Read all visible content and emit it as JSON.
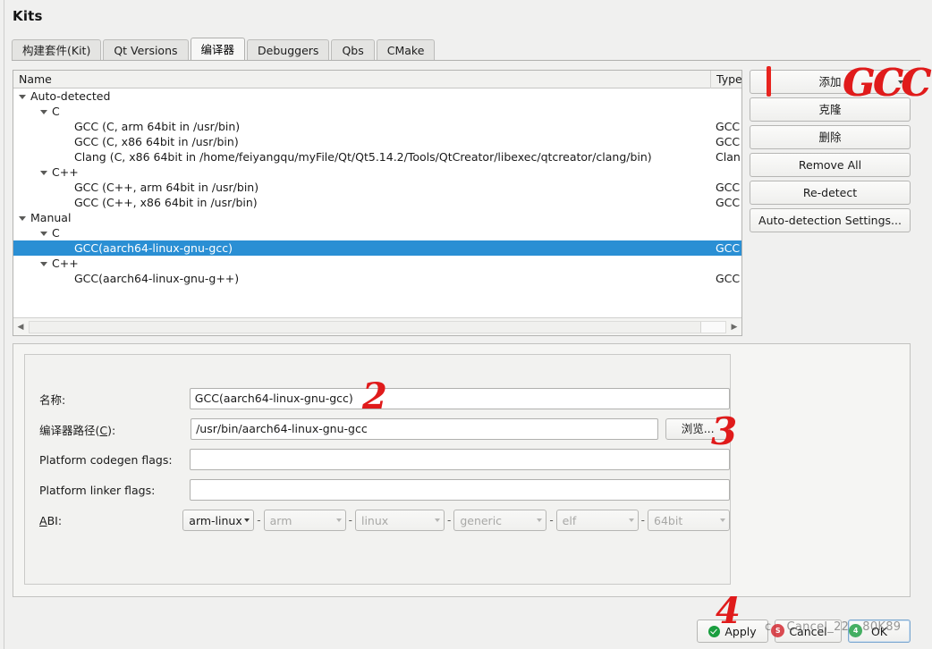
{
  "window": {
    "title": "Kits"
  },
  "tabs": [
    {
      "label": "构建套件(Kit)",
      "active": false
    },
    {
      "label": "Qt Versions",
      "active": false
    },
    {
      "label": "编译器",
      "active": true
    },
    {
      "label": "Debuggers",
      "active": false
    },
    {
      "label": "Qbs",
      "active": false
    },
    {
      "label": "CMake",
      "active": false
    }
  ],
  "tree": {
    "columns": {
      "name": "Name",
      "type": "Type"
    },
    "rows": [
      {
        "name": "Auto-detected",
        "type": "",
        "indent": 0,
        "expander": true,
        "selected": false
      },
      {
        "name": "C",
        "type": "",
        "indent": 1,
        "expander": true,
        "selected": false
      },
      {
        "name": "GCC (C, arm 64bit in /usr/bin)",
        "type": "GCC",
        "indent": 2,
        "expander": false,
        "selected": false
      },
      {
        "name": "GCC (C, x86 64bit in /usr/bin)",
        "type": "GCC",
        "indent": 2,
        "expander": false,
        "selected": false
      },
      {
        "name": "Clang (C, x86 64bit in /home/feiyangqu/myFile/Qt/Qt5.14.2/Tools/QtCreator/libexec/qtcreator/clang/bin)",
        "type": "Clan",
        "indent": 2,
        "expander": false,
        "selected": false
      },
      {
        "name": "C++",
        "type": "",
        "indent": 1,
        "expander": true,
        "selected": false
      },
      {
        "name": "GCC (C++, arm 64bit in /usr/bin)",
        "type": "GCC",
        "indent": 2,
        "expander": false,
        "selected": false
      },
      {
        "name": "GCC (C++, x86 64bit in /usr/bin)",
        "type": "GCC",
        "indent": 2,
        "expander": false,
        "selected": false
      },
      {
        "name": "Manual",
        "type": "",
        "indent": 0,
        "expander": true,
        "selected": false
      },
      {
        "name": "C",
        "type": "",
        "indent": 1,
        "expander": true,
        "selected": false
      },
      {
        "name": "GCC(aarch64-linux-gnu-gcc)",
        "type": "GCC",
        "indent": 2,
        "expander": false,
        "selected": true
      },
      {
        "name": "C++",
        "type": "",
        "indent": 1,
        "expander": true,
        "selected": false
      },
      {
        "name": "GCC(aarch64-linux-gnu-g++)",
        "type": "GCC",
        "indent": 2,
        "expander": false,
        "selected": false
      }
    ]
  },
  "side_buttons": [
    {
      "label": "添加",
      "dropdown": true
    },
    {
      "label": "克隆",
      "dropdown": false
    },
    {
      "label": "删除",
      "dropdown": false
    },
    {
      "label": "Remove All",
      "dropdown": false
    },
    {
      "label": "Re-detect",
      "dropdown": false
    },
    {
      "label": "Auto-detection Settings...",
      "dropdown": false
    }
  ],
  "details": {
    "name_label": "名称:",
    "name_value": "GCC(aarch64-linux-gnu-gcc)",
    "path_label_pre": "编译器路径(",
    "path_label_mnemonic": "C",
    "path_label_post": "):",
    "path_value": "/usr/bin/aarch64-linux-gnu-gcc",
    "browse_label": "浏览...",
    "codegen_label": "Platform codegen flags:",
    "codegen_value": "",
    "linker_label": "Platform linker flags:",
    "linker_value": "",
    "abi_label_mnemonic": "A",
    "abi_label_post": "BI:",
    "abi": [
      {
        "value": "arm-linux",
        "disabled": false
      },
      {
        "value": "arm",
        "disabled": true
      },
      {
        "value": "linux",
        "disabled": true
      },
      {
        "value": "generic",
        "disabled": true
      },
      {
        "value": "elf",
        "disabled": true
      },
      {
        "value": "64bit",
        "disabled": true
      }
    ]
  },
  "dialog_buttons": {
    "apply": "Apply",
    "cancel": "Cancel",
    "ok": "OK"
  },
  "annotations": {
    "mark_1": "1",
    "mark_gcc": "GCC",
    "mark_2": "2",
    "mark_3": "3",
    "mark_4": "4"
  },
  "watermark": {
    "prefix": "c",
    "logo": "S",
    "middle": "Cancel_",
    "number": "22",
    "badge": "4",
    "suffix": "80K89"
  }
}
